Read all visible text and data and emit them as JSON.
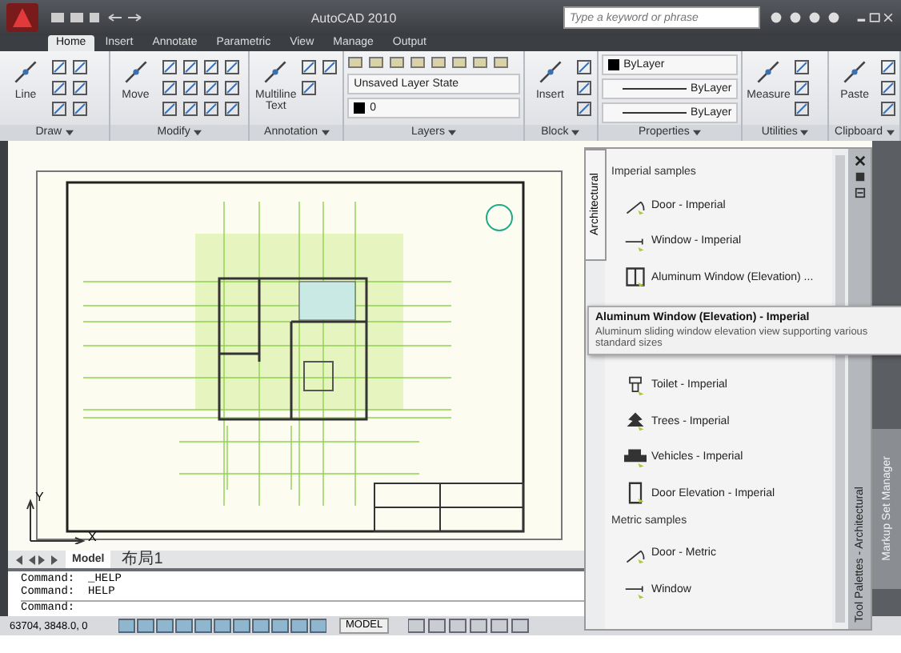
{
  "window": {
    "title": "AutoCAD 2010",
    "search_placeholder": "Type a keyword or phrase"
  },
  "ribbon_tabs": [
    {
      "label": "Home",
      "selected": true
    },
    {
      "label": "Insert",
      "selected": false
    },
    {
      "label": "Annotate",
      "selected": false
    },
    {
      "label": "Parametric",
      "selected": false
    },
    {
      "label": "View",
      "selected": false
    },
    {
      "label": "Manage",
      "selected": false
    },
    {
      "label": "Output",
      "selected": false
    }
  ],
  "panels": [
    {
      "kind": "tools",
      "title": "Draw",
      "button": "Line"
    },
    {
      "kind": "tools",
      "title": "Modify",
      "button": "Move"
    },
    {
      "kind": "tools",
      "title": "Annotation",
      "button": "Multiline Text"
    },
    {
      "kind": "layers",
      "title": "Layers",
      "layer_state": "Unsaved Layer State",
      "current_layer": "0"
    },
    {
      "kind": "tools",
      "title": "Block",
      "button": "Insert"
    },
    {
      "kind": "properties",
      "title": "Properties",
      "values": [
        "ByLayer",
        "ByLayer",
        "ByLayer"
      ]
    },
    {
      "kind": "tools",
      "title": "Utilities",
      "button": "Measure"
    },
    {
      "kind": "tools",
      "title": "Clipboard",
      "button": "Paste"
    }
  ],
  "ucs": {
    "x": "X",
    "y": "Y"
  },
  "palette": {
    "title": "Tool Palettes - Architectural",
    "tab": "Architectural",
    "sections": [
      {
        "title": "Imperial samples",
        "items": [
          {
            "kind": "door",
            "label": "Door - Imperial"
          },
          {
            "kind": "window",
            "label": "Window - Imperial"
          },
          {
            "kind": "aluminum-window",
            "label": "Aluminum Window (Elevation) ..."
          },
          {
            "kind": "toilet",
            "label": "Toilet - Imperial"
          },
          {
            "kind": "trees",
            "label": "Trees - Imperial"
          },
          {
            "kind": "vehicles",
            "label": "Vehicles - Imperial"
          },
          {
            "kind": "door-elevation",
            "label": "Door Elevation - Imperial"
          }
        ]
      },
      {
        "title": "Metric samples",
        "items": [
          {
            "kind": "door",
            "label": "Door - Metric"
          },
          {
            "kind": "window",
            "label": "Window"
          }
        ]
      }
    ]
  },
  "tooltip": {
    "title": "Aluminum Window (Elevation) - Imperial",
    "description": "Aluminum sliding window elevation view supporting various standard sizes"
  },
  "side_tabs": [
    "Markup Set Manager"
  ],
  "layout_tabs": [
    {
      "label": "Model",
      "selected": true
    },
    {
      "label": "布局1",
      "selected": false
    }
  ],
  "command_history": [
    "Command:  _HELP",
    "Command:  HELP"
  ],
  "command_prompt": "Command:",
  "status_bar": {
    "coordinates": "63704, 3848.0, 0",
    "space": "MODEL"
  }
}
